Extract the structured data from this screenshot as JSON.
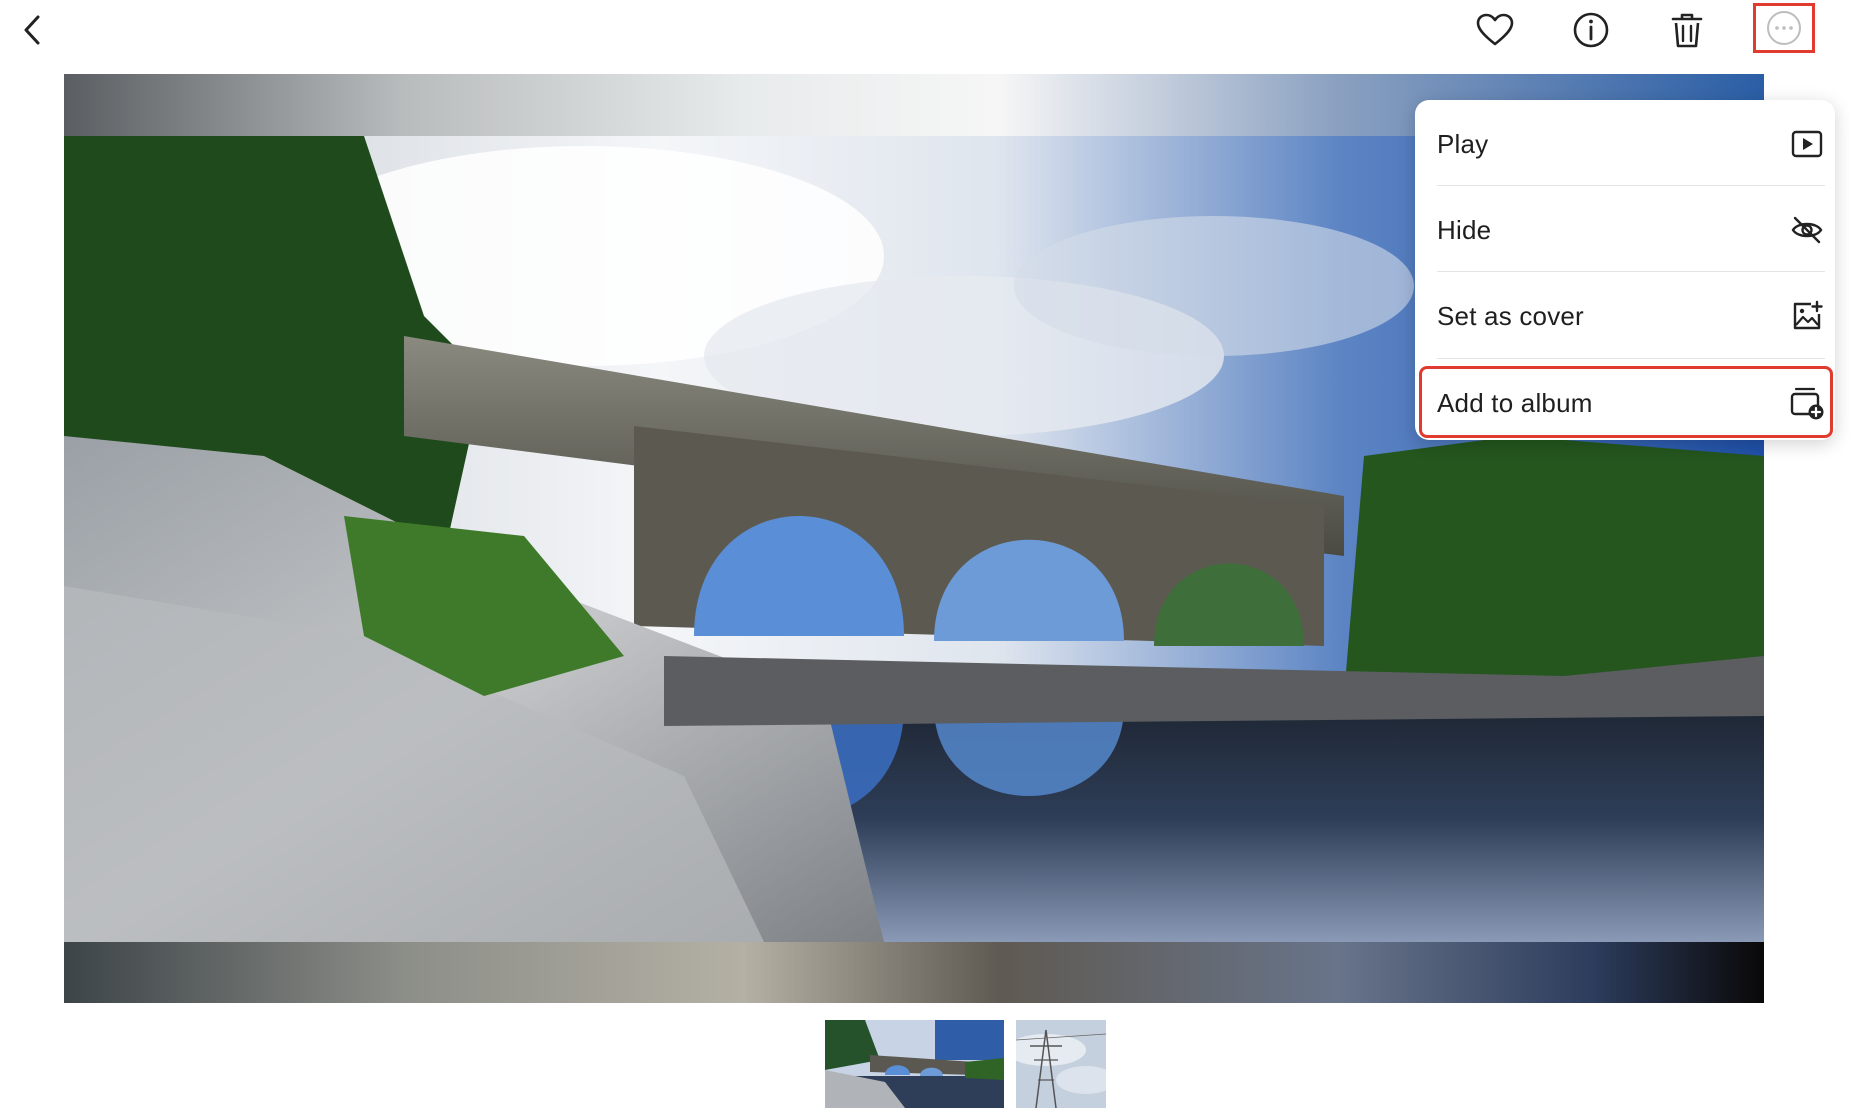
{
  "toolbar": {
    "back_icon": "chevron-left-icon",
    "favorite_icon": "heart-icon",
    "info_icon": "info-icon",
    "delete_icon": "trash-icon",
    "more_icon": "more-horizontal-icon"
  },
  "viewer": {
    "photo_subject": "stone-arch-bridge-over-river"
  },
  "menu": {
    "items": [
      {
        "label": "Play",
        "icon": "play-icon"
      },
      {
        "label": "Hide",
        "icon": "eye-off-icon"
      },
      {
        "label": "Set as cover",
        "icon": "image-plus-icon"
      },
      {
        "label": "Add to album",
        "icon": "album-add-icon"
      }
    ]
  },
  "filmstrip": {
    "thumbnails": [
      {
        "subject": "stone-arch-bridge",
        "selected": true
      },
      {
        "subject": "power-pylon-sky",
        "selected": false
      }
    ]
  },
  "colors": {
    "highlight": "#e03b2e",
    "menu_text": "#1f1f1f"
  }
}
